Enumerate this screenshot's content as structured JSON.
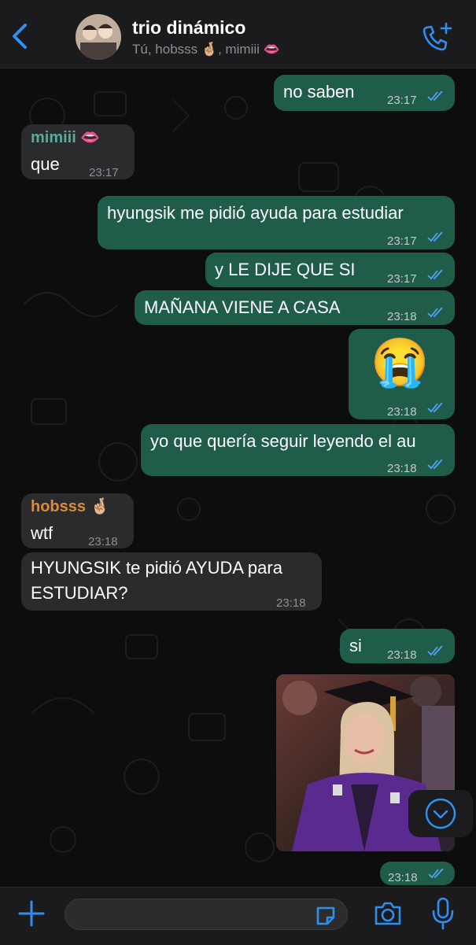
{
  "header": {
    "title": "trio dinámico",
    "subtitle": "Tú, hobsss 🤞🏼, mimiii 👄"
  },
  "messages": [
    {
      "dir": "out",
      "text": "no saben",
      "time": "23:17"
    },
    {
      "dir": "in",
      "sender": "mimiii 👄",
      "sender_color": "#5ea89a",
      "text": "que",
      "time": "23:17"
    },
    {
      "dir": "out",
      "text": "hyungsik me pidió ayuda para estudiar",
      "time": "23:17"
    },
    {
      "dir": "out",
      "text": "y LE DIJE QUE SI",
      "time": "23:17"
    },
    {
      "dir": "out",
      "text": "MAÑANA VIENE A CASA",
      "time": "23:18"
    },
    {
      "dir": "out",
      "text": "😭",
      "time": "23:18"
    },
    {
      "dir": "out",
      "text": "yo que quería seguir leyendo el au",
      "time": "23:18"
    },
    {
      "dir": "in",
      "sender": "hobsss 🤞🏼",
      "sender_color": "#d98a3a",
      "text": "wtf",
      "time": "23:18"
    },
    {
      "dir": "in",
      "text_line1": "HYUNGSIK te pidió AYUDA para",
      "text_line2": "ESTUDIAR?",
      "time": "23:18"
    },
    {
      "dir": "out",
      "text": "si",
      "time": "23:18"
    },
    {
      "dir": "out",
      "media": "photo",
      "time": "23:18"
    }
  ],
  "colors": {
    "accent": "#2f8ff0",
    "bubble_out": "#1f5c4a",
    "bubble_in": "#2b2b2d"
  },
  "icons": [
    "back-chevron-icon",
    "add-call-icon",
    "plus-icon",
    "sticker-icon",
    "camera-icon",
    "microphone-icon",
    "scroll-down-icon",
    "read-ticks-icon"
  ]
}
